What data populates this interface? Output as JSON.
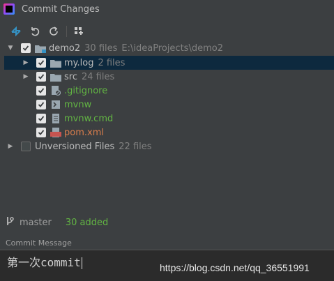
{
  "window": {
    "title": "Commit Changes"
  },
  "toolbar": {
    "buttons": [
      {
        "icon": "show-diff-icon"
      },
      {
        "icon": "rollback-icon"
      },
      {
        "icon": "refresh-icon"
      },
      {
        "icon": "group-by-icon"
      }
    ]
  },
  "tree": {
    "root": {
      "name": "demo2",
      "count": "30 files",
      "path": "E:\\ideaProjects\\demo2"
    },
    "items": [
      {
        "name": "my.log",
        "count": "2 files",
        "type": "folder"
      },
      {
        "name": "src",
        "count": "24 files",
        "type": "folder"
      },
      {
        "name": ".gitignore",
        "type": "file"
      },
      {
        "name": "mvnw",
        "type": "file"
      },
      {
        "name": "mvnw.cmd",
        "type": "file"
      },
      {
        "name": "pom.xml",
        "type": "file"
      }
    ],
    "unversioned": {
      "name": "Unversioned Files",
      "count": "22 files"
    }
  },
  "status": {
    "branch": "master",
    "added": "30 added"
  },
  "commit": {
    "label": "Commit Message",
    "message": "第一次commit"
  },
  "watermark": "https://blog.csdn.net/qq_36551991",
  "colors": {
    "added": "#62b543",
    "selected": "#0d293e",
    "accent": "#3592c4"
  }
}
